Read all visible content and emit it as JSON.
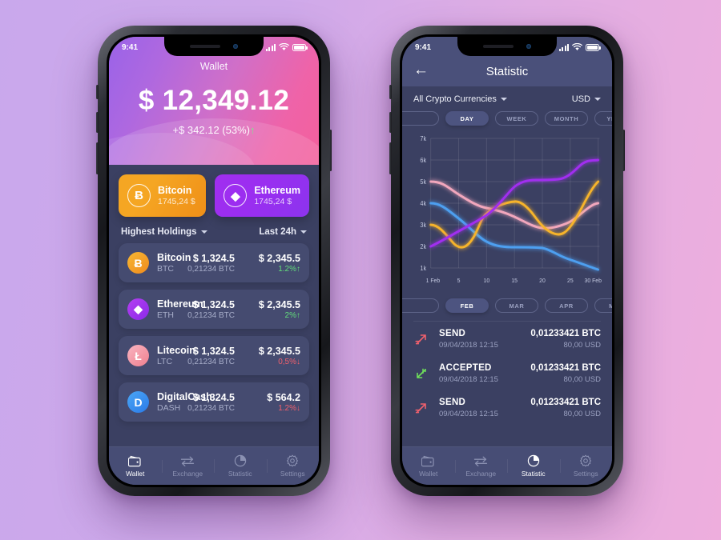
{
  "background": {
    "from": "#c9a8ec",
    "to": "#eeaedd"
  },
  "phone1": {
    "status": {
      "time": "9:41"
    },
    "hero": {
      "title": "Wallet",
      "amount": "$ 12,349.12",
      "delta": "+$ 342.12 (53%)",
      "delta_arrow": "↑"
    },
    "cards": [
      {
        "name": "Bitcoin",
        "price": "1745,24 $",
        "glyph": "Ƀ",
        "theme": "btc"
      },
      {
        "name": "Ethereum",
        "price": "1745,24 $",
        "glyph": "◆",
        "theme": "eth"
      }
    ],
    "filters": {
      "left": "Highest Holdings",
      "right": "Last 24h"
    },
    "coins": [
      {
        "name": "Bitcoin",
        "symbol": "BTC",
        "usd": "$ 1,324.5",
        "btc": "0,21234 BTC",
        "value": "$ 2,345.5",
        "change": "1.2%",
        "arrow": "↑",
        "dir": "pos",
        "theme": "ic-btc",
        "glyph": "Ƀ"
      },
      {
        "name": "Ethereum",
        "symbol": "ETH",
        "usd": "$ 1,324.5",
        "btc": "0,21234 BTC",
        "value": "$ 2,345.5",
        "change": "2%",
        "arrow": "↑",
        "dir": "pos",
        "theme": "ic-eth",
        "glyph": "◆"
      },
      {
        "name": "Litecoin",
        "symbol": "LTC",
        "usd": "$ 1,324.5",
        "btc": "0,21234 BTC",
        "value": "$ 2,345.5",
        "change": "0,5%",
        "arrow": "↓",
        "dir": "neg",
        "theme": "ic-ltc",
        "glyph": "Ł"
      },
      {
        "name": "DigitalCash",
        "symbol": "DASH",
        "usd": "$ 1,324.5",
        "btc": "0,21234 BTC",
        "value": "$ 564.2",
        "change": "1.2%",
        "arrow": "↓",
        "dir": "neg",
        "theme": "ic-dash",
        "glyph": "D"
      }
    ],
    "tabs": [
      {
        "label": "Wallet",
        "icon": "wallet-icon",
        "active": true
      },
      {
        "label": "Exchange",
        "icon": "exchange-icon",
        "active": false
      },
      {
        "label": "Statistic",
        "icon": "pie-chart-icon",
        "active": false
      },
      {
        "label": "Settings",
        "icon": "gear-icon",
        "active": false
      }
    ]
  },
  "phone2": {
    "status": {
      "time": "9:41"
    },
    "header": {
      "title": "Statistic",
      "back": "←"
    },
    "filters": {
      "currency": "All Crypto Currencies",
      "fiat": "USD"
    },
    "ranges": [
      {
        "label": "",
        "active": false
      },
      {
        "label": "DAY",
        "active": true
      },
      {
        "label": "WEEK",
        "active": false
      },
      {
        "label": "MONTH",
        "active": false
      },
      {
        "label": "YEAR",
        "active": false
      }
    ],
    "months": [
      {
        "label": "",
        "active": false
      },
      {
        "label": "FEB",
        "active": true
      },
      {
        "label": "MAR",
        "active": false
      },
      {
        "label": "APR",
        "active": false
      },
      {
        "label": "MAY",
        "active": false
      },
      {
        "label": "",
        "active": false
      }
    ],
    "transactions": [
      {
        "type": "SEND",
        "date": "09/04/2018 12:15",
        "amount": "0,01233421 BTC",
        "fiat": "80,00 USD",
        "icon": "arrow-send-icon"
      },
      {
        "type": "ACCEPTED",
        "date": "09/04/2018 12:15",
        "amount": "0,01233421 BTC",
        "fiat": "80,00 USD",
        "icon": "arrow-receive-icon"
      },
      {
        "type": "SEND",
        "date": "09/04/2018 12:15",
        "amount": "0,01233421 BTC",
        "fiat": "80,00 USD",
        "icon": "arrow-send-icon"
      }
    ],
    "tabs": [
      {
        "label": "Wallet",
        "icon": "wallet-icon",
        "active": false
      },
      {
        "label": "Exchange",
        "icon": "exchange-icon",
        "active": false
      },
      {
        "label": "Statistic",
        "icon": "pie-chart-icon",
        "active": true
      },
      {
        "label": "Settings",
        "icon": "gear-icon",
        "active": false
      }
    ]
  },
  "chart_data": {
    "type": "line",
    "title": "Statistic",
    "xlabel": "",
    "ylabel": "",
    "grid": true,
    "legend": "none",
    "ylim": [
      1000,
      7000
    ],
    "yticks": [
      7000,
      6000,
      5000,
      4000,
      3000,
      2000,
      1000
    ],
    "ytick_labels": [
      "7k",
      "6k",
      "5k",
      "4k",
      "3k",
      "2k",
      "1k"
    ],
    "xticks": [
      1,
      5,
      10,
      15,
      20,
      25,
      30
    ],
    "xtick_labels": [
      "1 Feb",
      "5",
      "10",
      "15",
      "20",
      "25",
      "30 Feb"
    ],
    "x": [
      1,
      5,
      10,
      15,
      20,
      25,
      30
    ],
    "series": [
      {
        "name": "pink",
        "color": "#f2a7bd",
        "values": [
          5000,
          4750,
          4100,
          3600,
          3050,
          3300,
          4000
        ]
      },
      {
        "name": "blue",
        "color": "#4d9ff0",
        "values": [
          4000,
          3500,
          2700,
          2150,
          2000,
          1700,
          1000
        ]
      },
      {
        "name": "orange",
        "color": "#f7b42c",
        "values": [
          3000,
          2050,
          2900,
          4050,
          3600,
          3050,
          5000
        ]
      },
      {
        "name": "purple",
        "color": "#a12ef0",
        "values": [
          2000,
          2450,
          2950,
          3900,
          5050,
          5150,
          6000
        ]
      }
    ]
  }
}
